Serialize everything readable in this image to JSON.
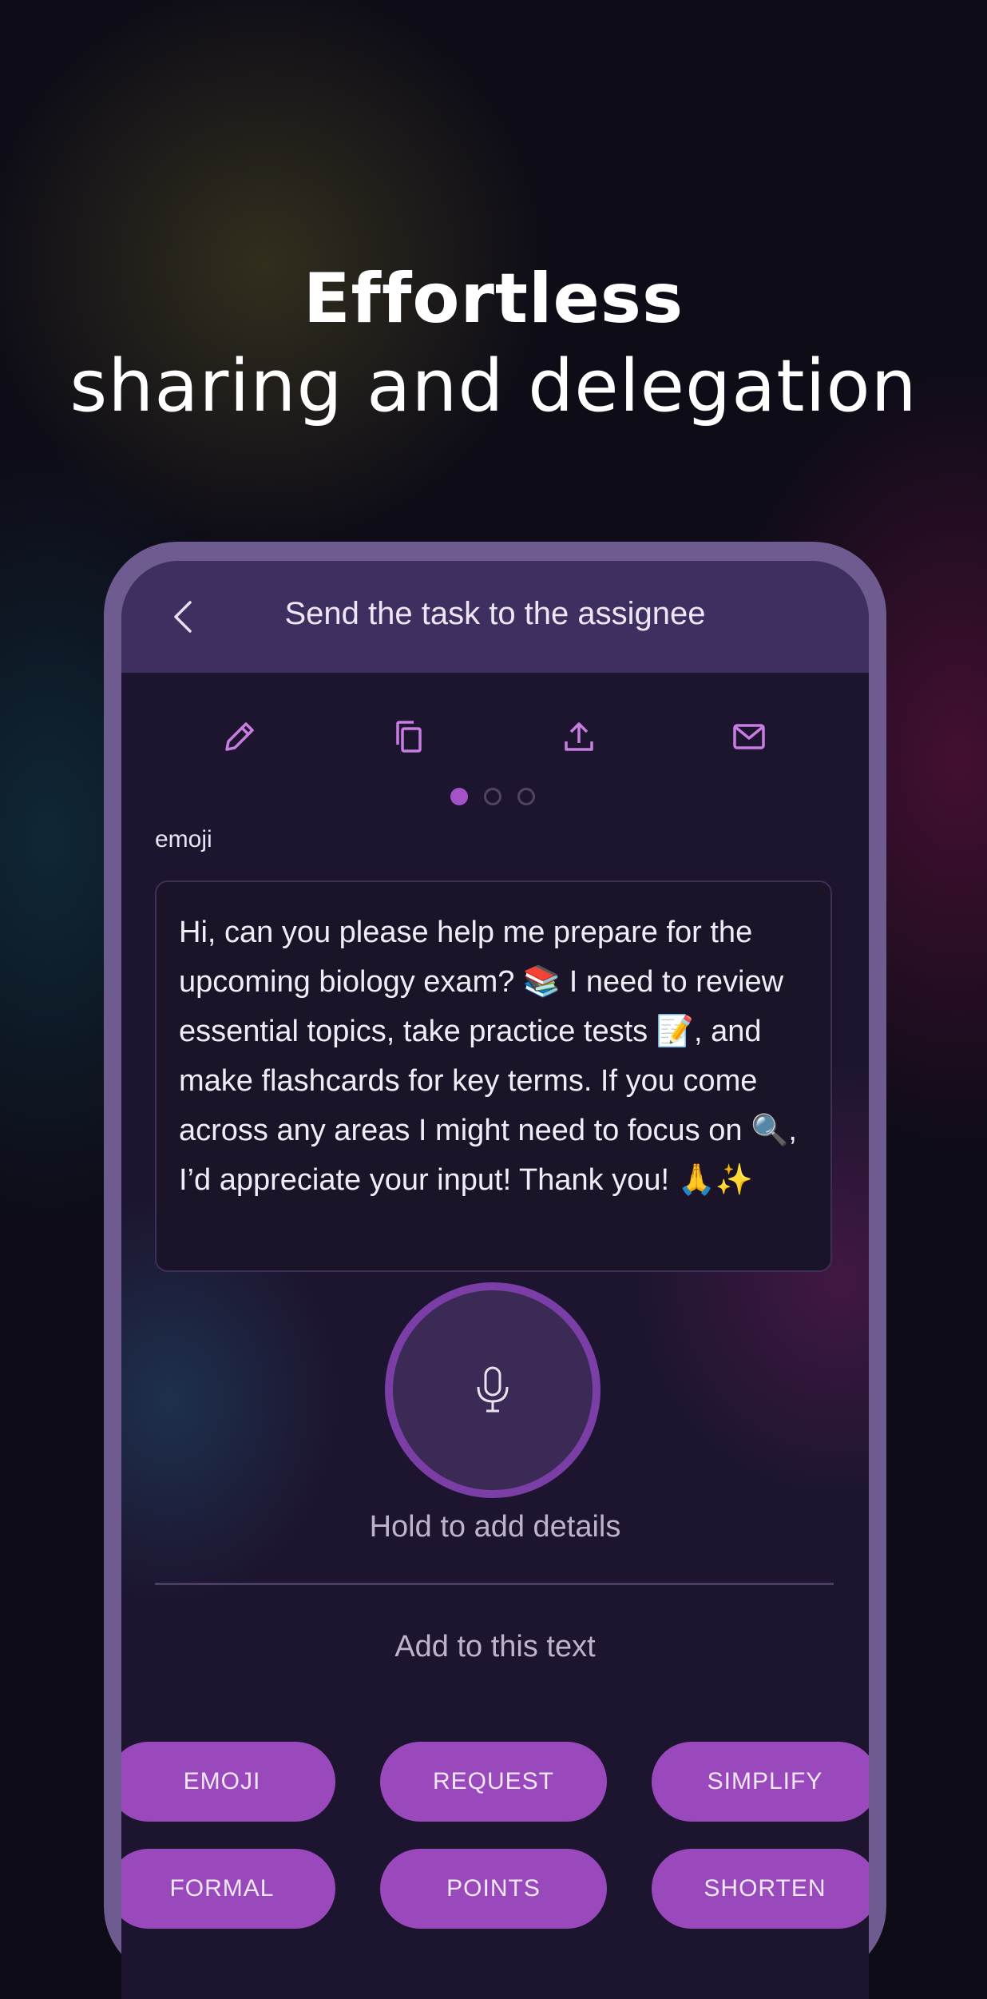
{
  "headline": {
    "line1": "Effortless",
    "line2": "sharing and delegation"
  },
  "screen": {
    "title": "Send the task to the assignee",
    "toolbar_icons": [
      "pencil-icon",
      "copy-icon",
      "upload-icon",
      "mail-icon"
    ],
    "pager": {
      "total": 3,
      "active": 1
    },
    "section_label": "emoji",
    "message": "Hi, can you please help me prepare for the upcoming biology exam? 📚 I need to review essential topics, take practice tests 📝, and make flashcards for key terms. If you come across any areas I might need to focus on 🔍, I’d appreciate your input! Thank you! 🙏✨",
    "mic_hint": "Hold to add details",
    "add_label": "Add to this text",
    "chips": [
      "EMOJI",
      "REQUEST",
      "SIMPLIFY",
      "FORMAL",
      "POINTS",
      "SHORTEN"
    ]
  },
  "colors": {
    "accent": "#9a49bd",
    "icon": "#c77ee0",
    "topbar": "#3f2f60",
    "phone_frame": "#6e5b90"
  }
}
